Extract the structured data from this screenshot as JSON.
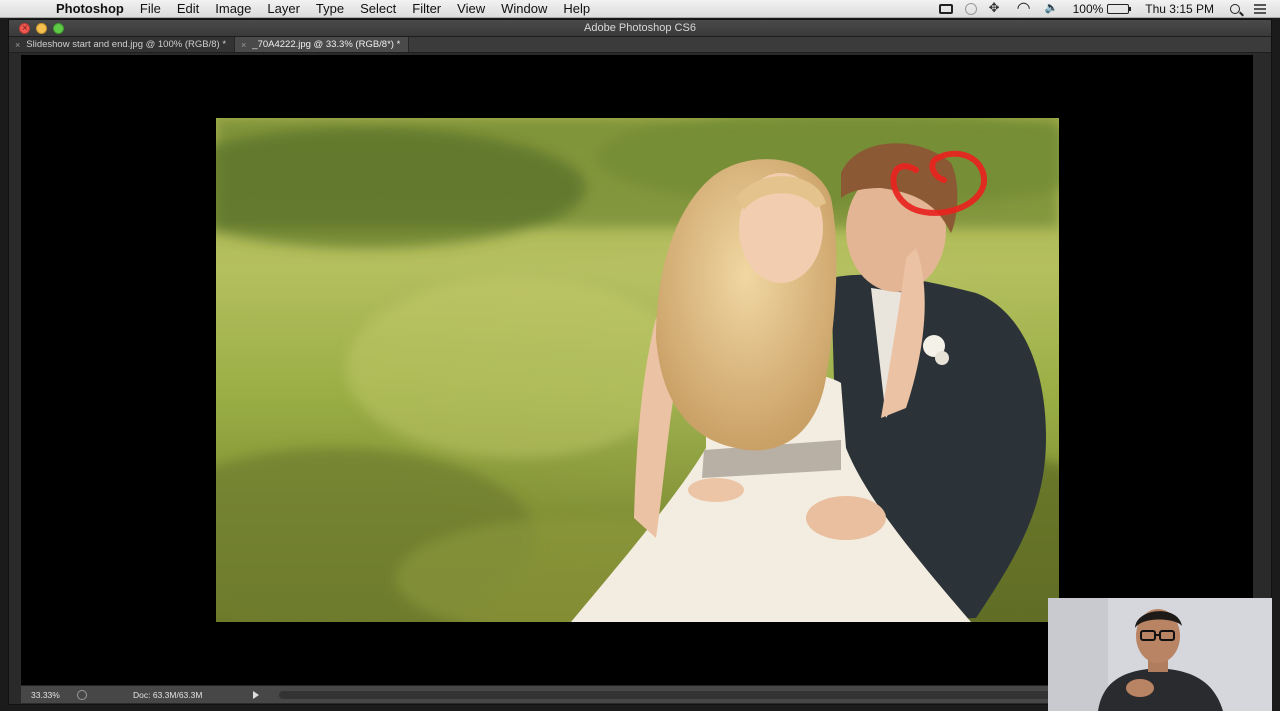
{
  "menubar": {
    "app_name": "Photoshop",
    "items": [
      "File",
      "Edit",
      "Image",
      "Layer",
      "Type",
      "Select",
      "Filter",
      "View",
      "Window",
      "Help"
    ],
    "battery": "100%",
    "clock": "Thu 3:15 PM"
  },
  "window": {
    "title": "Adobe Photoshop CS6",
    "tabs": [
      {
        "label": "Slideshow start and end.jpg @ 100% (RGB/8) *",
        "active": false
      },
      {
        "label": "_70A4222.jpg @ 33.3% (RGB/8*) *",
        "active": true
      }
    ]
  },
  "statusbar": {
    "zoom": "33.33%",
    "doc_info": "Doc: 63.3M/63.3M"
  },
  "colors": {
    "annotation": "#e8231e",
    "canvas_bg": "#000000",
    "grass": "#a8b24e"
  }
}
